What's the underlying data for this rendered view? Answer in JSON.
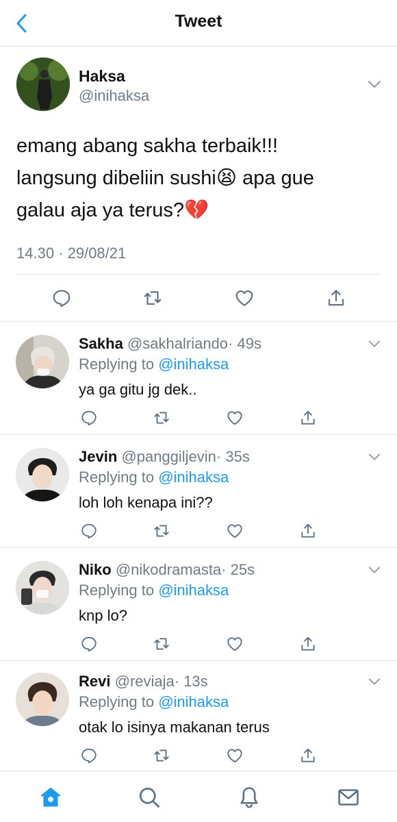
{
  "header": {
    "title": "Tweet"
  },
  "main_tweet": {
    "name": "Haksa",
    "handle": "@inihaksa",
    "lines": [
      "emang abang sakha terbaik!!!",
      "langsung dibeliin sushi😫 apa gue",
      "galau aja ya terus?💔"
    ],
    "meta": "14.30 · 29/08/21"
  },
  "replies": [
    {
      "name": "Sakha",
      "handle": "@sakhalriando",
      "time": "· 49s",
      "replying_prefix": "Replying to ",
      "mention": "@inihaksa",
      "text": "ya ga gitu jg dek.."
    },
    {
      "name": "Jevin",
      "handle": "@panggiljevin",
      "time": "· 35s",
      "replying_prefix": "Replying to ",
      "mention": "@inihaksa",
      "text": "loh loh kenapa ini??"
    },
    {
      "name": "Niko",
      "handle": "@nikodramasta",
      "time": "· 25s",
      "replying_prefix": "Replying to ",
      "mention": "@inihaksa",
      "text": "knp lo?"
    },
    {
      "name": "Revi",
      "handle": "@reviaja",
      "time": "· 13s",
      "replying_prefix": "Replying to ",
      "mention": "@inihaksa",
      "text": "otak lo isinya makanan terus"
    }
  ],
  "colors": {
    "accent": "#1d9bf0",
    "muted": "#6f7c87",
    "icon": "#5b7083"
  },
  "icons": {
    "back": "chevron-left-icon",
    "more": "chevron-down-icon",
    "reply": "comment-icon",
    "retweet": "retweet-icon",
    "like": "heart-icon",
    "share": "share-icon",
    "nav": [
      "home-icon",
      "search-icon",
      "bell-icon",
      "mail-icon"
    ]
  }
}
